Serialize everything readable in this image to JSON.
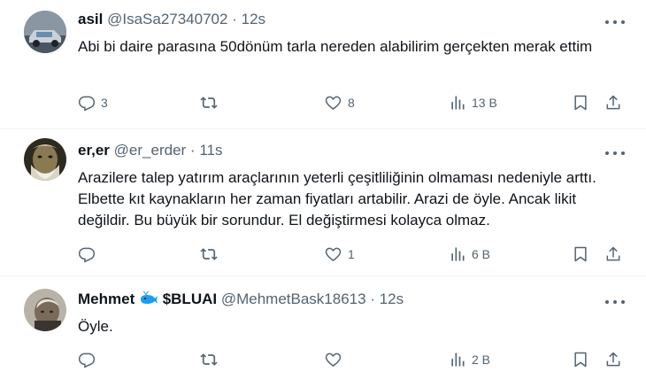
{
  "tweets": [
    {
      "name": "asil",
      "handle": "@IsaSa27340702",
      "separator": "·",
      "time": "12s",
      "text": "Abi bi daire parasına 50dönüm tarla nereden alabilirim gerçekten merak ettim",
      "replies": "3",
      "retweets": "",
      "likes": "8",
      "views": "13 B"
    },
    {
      "name": "er,er",
      "handle": "@er_erder",
      "separator": "·",
      "time": "11s",
      "text": "Arazilere talep yatırım araçlarının yeterli çeşitliliğinin olmaması nedeniyle arttı. Elbette kıt kaynakların her zaman fiyatları artabilir. Arazi de öyle. Ancak likit değildir. Bu büyük bir sorundur. El değiştirmesi kolayca olmaz.",
      "replies": "",
      "retweets": "",
      "likes": "1",
      "views": "6 B"
    },
    {
      "name": "Mehmet",
      "name_suffix": "$BLUAI",
      "handle": "@MehmetBask18613",
      "separator": "·",
      "time": "12s",
      "text": "Öyle.",
      "replies": "",
      "retweets": "",
      "likes": "",
      "views": "2 B"
    }
  ],
  "icons": {
    "reply": "reply-icon",
    "retweet": "retweet-icon",
    "like": "like-icon",
    "views": "views-icon",
    "bookmark": "bookmark-icon",
    "share": "share-icon",
    "more": "more-icon",
    "emoji": "whale-emoji"
  },
  "colors": {
    "text": "#0f1419",
    "secondary": "#536471",
    "divider": "#eff3f4",
    "whale": "#1d9bf0"
  }
}
